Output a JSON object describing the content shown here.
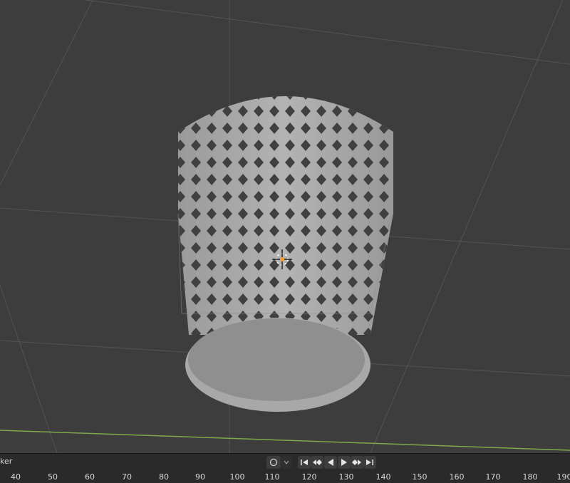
{
  "timeline": {
    "marker_label": "ker",
    "ruler_ticks": [
      "40",
      "50",
      "60",
      "70",
      "80",
      "90",
      "100",
      "110",
      "120",
      "130",
      "140",
      "150",
      "160",
      "170",
      "180",
      "190"
    ]
  },
  "icons": {
    "keyframe": "circle-keyframe-icon",
    "jump_start": "jump-to-start-icon",
    "prev_keyframe": "previous-keyframe-icon",
    "play_reverse": "play-reverse-icon",
    "play": "play-icon",
    "next_keyframe": "next-keyframe-icon",
    "jump_end": "jump-to-end-icon"
  },
  "colors": {
    "viewport_bg": "#3d3d3d",
    "grid": "#545454",
    "x_axis": "#7da84a",
    "object": "#a3a3a3",
    "origin": "#f0a030"
  }
}
